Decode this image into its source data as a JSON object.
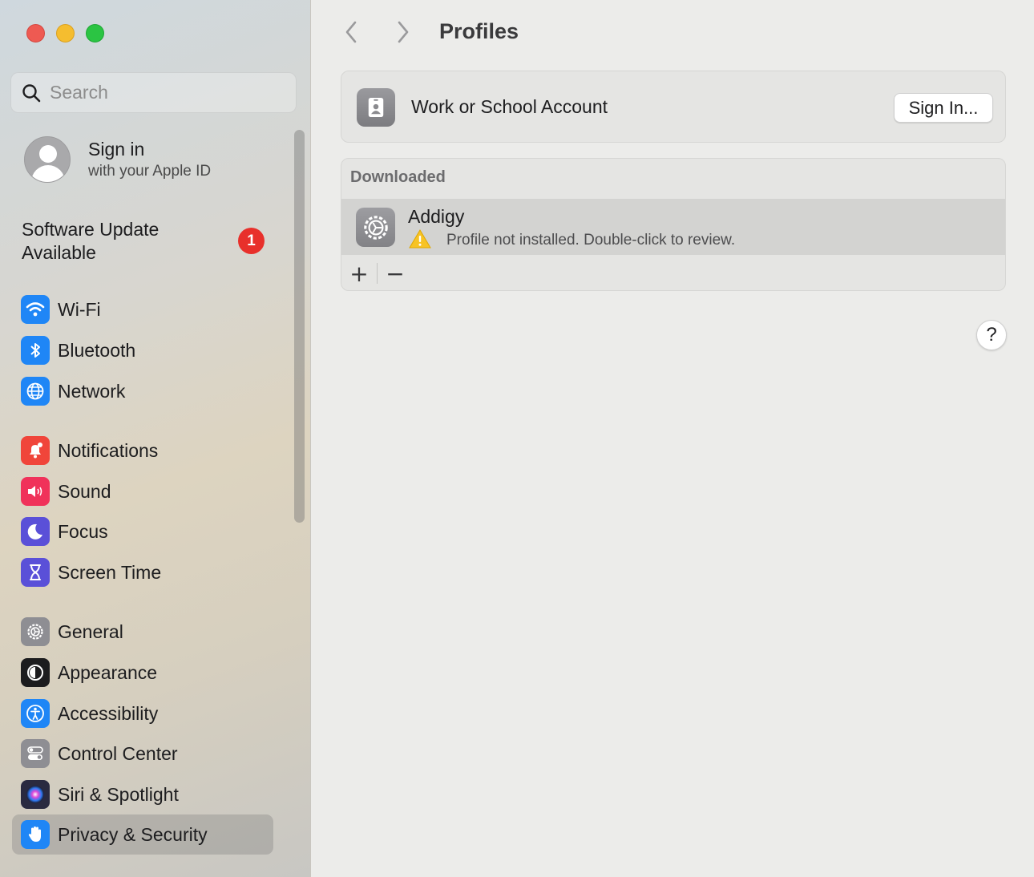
{
  "window": {
    "traffic_lights": [
      "close",
      "minimize",
      "zoom"
    ]
  },
  "sidebar": {
    "search": {
      "placeholder": "Search",
      "value": ""
    },
    "apple_id": {
      "title": "Sign in",
      "subtitle": "with your Apple ID"
    },
    "software_update": {
      "label": "Software Update Available",
      "badge": "1"
    },
    "items": [
      {
        "label": "Wi-Fi",
        "icon": "wifi-icon",
        "color": "#1f86f6"
      },
      {
        "label": "Bluetooth",
        "icon": "bluetooth-icon",
        "color": "#1f86f6"
      },
      {
        "label": "Network",
        "icon": "globe-icon",
        "color": "#1f86f6"
      },
      {
        "label": "Notifications",
        "icon": "bell-icon",
        "color": "#f0453a"
      },
      {
        "label": "Sound",
        "icon": "speaker-icon",
        "color": "#f0325a"
      },
      {
        "label": "Focus",
        "icon": "moon-icon",
        "color": "#5a50d8"
      },
      {
        "label": "Screen Time",
        "icon": "hourglass-icon",
        "color": "#5a50d8"
      },
      {
        "label": "General",
        "icon": "gear-icon",
        "color": "#8e8e93"
      },
      {
        "label": "Appearance",
        "icon": "appearance-icon",
        "color": "#1c1c1e"
      },
      {
        "label": "Accessibility",
        "icon": "accessibility-icon",
        "color": "#1f86f6"
      },
      {
        "label": "Control Center",
        "icon": "toggles-icon",
        "color": "#8e8e93"
      },
      {
        "label": "Siri & Spotlight",
        "icon": "siri-icon",
        "color": "#2a2a40"
      },
      {
        "label": "Privacy & Security",
        "icon": "hand-icon",
        "color": "#1f86f6",
        "selected": true
      }
    ]
  },
  "main": {
    "title": "Profiles",
    "account": {
      "label": "Work or School Account",
      "button": "Sign In..."
    },
    "downloaded": {
      "header": "Downloaded",
      "profiles": [
        {
          "name": "Addigy",
          "status": "Profile not installed. Double-click to review."
        }
      ],
      "add_label": "+",
      "remove_label": "−"
    },
    "help_label": "?"
  }
}
